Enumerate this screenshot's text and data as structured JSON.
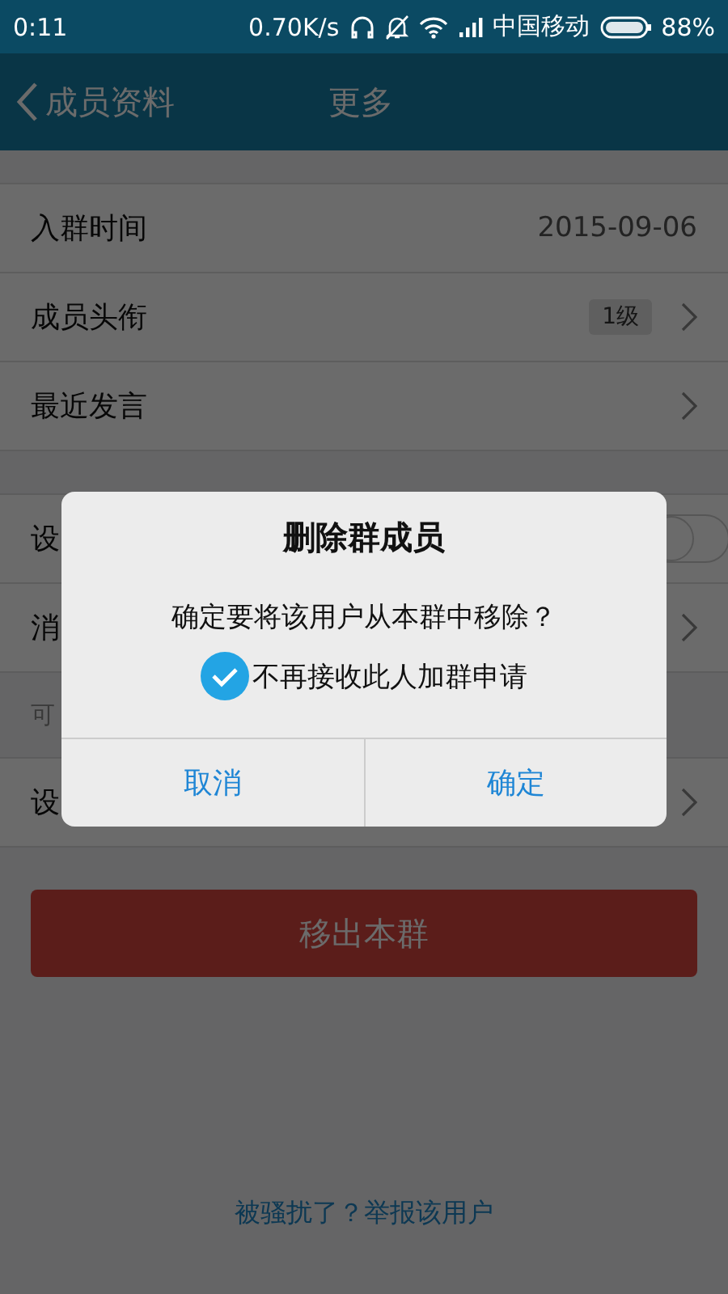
{
  "status_bar": {
    "time": "0:11",
    "speed": "0.70K/s",
    "carrier": "中国移动",
    "battery": "88%"
  },
  "nav": {
    "back_label": "成员资料",
    "title": "更多"
  },
  "info_rows": [
    {
      "kind": "value",
      "label": "入群时间",
      "value": "2015-09-06"
    },
    {
      "kind": "badge",
      "label": "成员头衔",
      "badge": "1级"
    },
    {
      "kind": "chevron",
      "label": "最近发言"
    }
  ],
  "settings_rows": [
    {
      "kind": "toggle",
      "label": "设",
      "on": false
    },
    {
      "kind": "chevron",
      "label": "消"
    },
    {
      "kind": "hint",
      "label": "可"
    },
    {
      "kind": "chevron",
      "label": "设"
    }
  ],
  "remove_button": "移出本群",
  "report_link": "被骚扰了？举报该用户",
  "dialog": {
    "title": "删除群成员",
    "message": "确定要将该用户从本群中移除？",
    "checkbox": {
      "label": "不再接收此人加群申请",
      "checked": true
    },
    "buttons": [
      "取消",
      "确定"
    ]
  }
}
